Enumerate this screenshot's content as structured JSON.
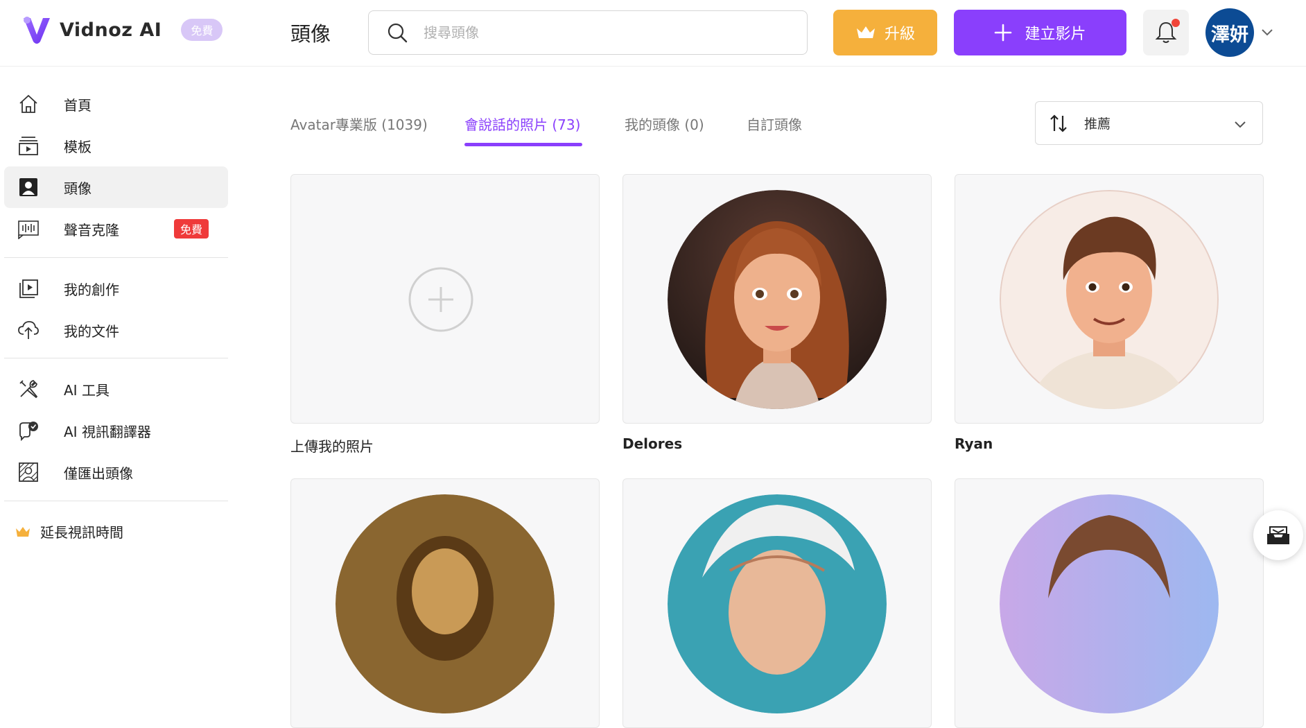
{
  "header": {
    "logo_text": "Vidnoz AI",
    "free_badge": "免費",
    "page_title": "頭像",
    "search_placeholder": "搜尋頭像",
    "upgrade_label": "升級",
    "create_label": "建立影片",
    "avatar_initials": "澤妍"
  },
  "sidebar": {
    "items": [
      {
        "label": "首頁",
        "icon": "home-icon"
      },
      {
        "label": "模板",
        "icon": "template-icon"
      },
      {
        "label": "頭像",
        "icon": "avatar-icon",
        "active": true
      },
      {
        "label": "聲音克隆",
        "icon": "voice-wave-icon",
        "badge": "免費"
      },
      {
        "label": "我的創作",
        "icon": "play-stack-icon"
      },
      {
        "label": "我的文件",
        "icon": "cloud-upload-icon"
      },
      {
        "label": "AI 工具",
        "icon": "tools-icon"
      },
      {
        "label": "AI 視訊翻譯器",
        "icon": "translate-icon"
      },
      {
        "label": "僅匯出頭像",
        "icon": "export-avatar-icon"
      }
    ],
    "extend_label": "延長視訊時間"
  },
  "tabs": [
    {
      "label": "Avatar專業版 (1039)"
    },
    {
      "label": "會說話的照片 (73)",
      "active": true
    },
    {
      "label": "我的頭像 (0)"
    },
    {
      "label": "自訂頭像"
    }
  ],
  "sort": {
    "label": "推薦"
  },
  "cards": [
    {
      "label": "上傳我的照片",
      "type": "upload"
    },
    {
      "label": "Delores",
      "type": "portrait"
    },
    {
      "label": "Ryan",
      "type": "portrait"
    }
  ],
  "colors": {
    "accent": "#8a3ffc",
    "upgrade": "#f5b03c",
    "badge_red": "#ef3a3a",
    "avatar_bg": "#0c4b94"
  }
}
